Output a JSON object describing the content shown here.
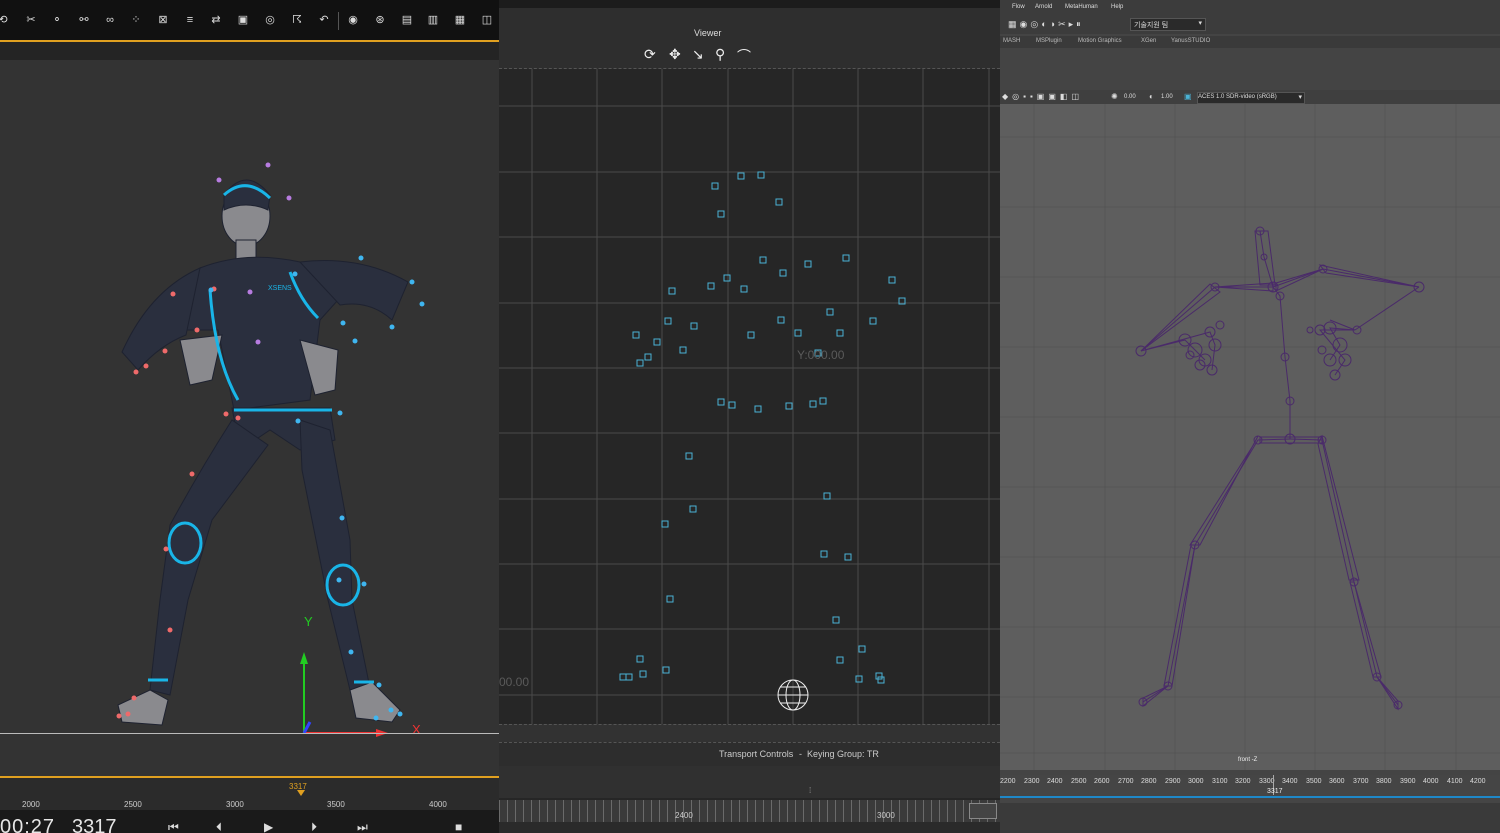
{
  "panel_left": {
    "toolbar_icons": [
      "rotate-tool-icon",
      "scissors-icon",
      "bone-link-icon",
      "bone-pair-icon",
      "chain-icon",
      "dots-icon",
      "cross-x-icon",
      "list-filter-icon",
      "shuffle-icon",
      "frame-select-icon",
      "ring-target-icon",
      "figure-run-icon",
      "undo-icon",
      "record-dot-icon",
      "circle-grid-icon",
      "panel-a-icon",
      "panel-b-icon",
      "panel-c-icon",
      "graph-icon"
    ],
    "axis_y": "Y",
    "axis_x": "X",
    "suit_logo": "XSENS",
    "ruler_ticks": [
      "2000",
      "2500",
      "3000",
      "3500",
      "4000"
    ],
    "current_frame_flag": "3317",
    "timecode": "00:27",
    "frame": "3317",
    "accent": "#e0a020"
  },
  "panel_middle": {
    "title": "Viewer",
    "y_readout": "Y:000.00",
    "x_readout": "00.00",
    "transport_label": "Transport Controls",
    "keying_label": "Keying Group: TR",
    "ruler_ticks": [
      "2400",
      "3000"
    ],
    "marker_color": "#4ab3d6"
  },
  "panel_right": {
    "menus": [
      "Flow",
      "Arnold",
      "MetaHuman",
      "Help"
    ],
    "workspace_dropdown": "기술지원 팀",
    "shelf_tabs": [
      "MASH",
      "MSPlugin",
      "Motion Graphics",
      "XGen",
      "YanusSTUDIO"
    ],
    "exposure": "0.00",
    "gamma": "1.00",
    "color_space": "ACES 1.0 SDR-video (sRGB)",
    "camera_label": "front -Z",
    "timeline_ticks": [
      "2200",
      "2300",
      "2400",
      "2500",
      "2600",
      "2700",
      "2800",
      "2900",
      "3000",
      "3100",
      "3200",
      "3300",
      "3400",
      "3500",
      "3600",
      "3700",
      "3800",
      "3900",
      "4000",
      "4100",
      "4200"
    ],
    "current_frame": "3317",
    "rig_color": "#4a2a6a"
  }
}
